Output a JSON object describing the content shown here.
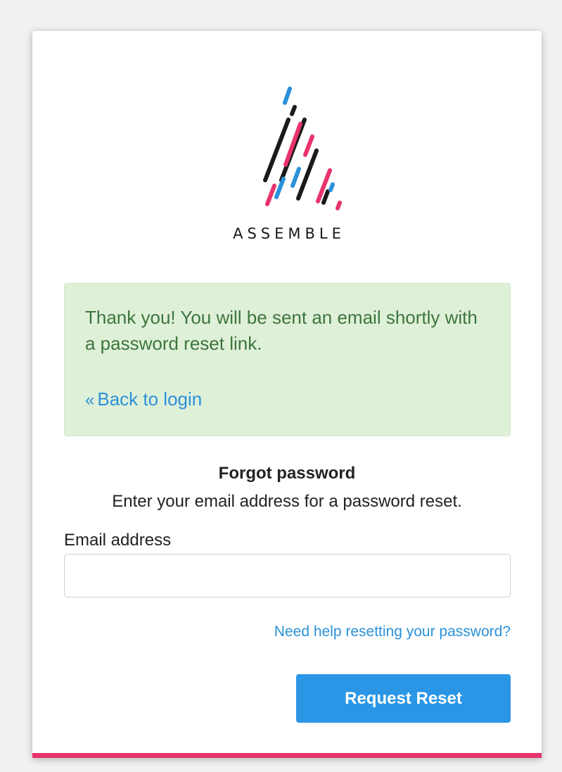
{
  "brand": {
    "name": "ASSEMBLE",
    "colors": {
      "pink": "#e8336b",
      "blue": "#2b91d9",
      "black": "#1a1a1a"
    }
  },
  "alert": {
    "message": "Thank you! You will be sent an email shortly with a password reset link.",
    "back_link_icon": "«",
    "back_link_label": "Back to login"
  },
  "form": {
    "title": "Forgot password",
    "subtitle": "Enter your email address for a password reset.",
    "email_label": "Email address",
    "email_value": "",
    "email_placeholder": "",
    "help_link": "Need help resetting your password?",
    "submit_label": "Request Reset"
  }
}
